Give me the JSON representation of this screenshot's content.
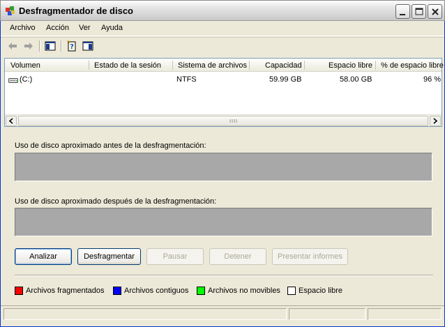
{
  "window": {
    "title": "Desfragmentador de disco",
    "icon": "defrag-app-icon"
  },
  "menu": {
    "items": [
      "Archivo",
      "Acción",
      "Ver",
      "Ayuda"
    ]
  },
  "toolbar": {
    "buttons": [
      "back-arrow-icon",
      "forward-arrow-icon",
      "show-hide-console-tree-icon",
      "help-icon",
      "properties-icon"
    ]
  },
  "volumes": {
    "columns": [
      "Volumen",
      "Estado de la sesión",
      "Sistema de archivos",
      "Capacidad",
      "Espacio libre",
      "% de espacio libre"
    ],
    "rows": [
      {
        "volume": "(C:)",
        "status": "",
        "filesystem": "NTFS",
        "capacity": "59.99 GB",
        "free_space": "58.00 GB",
        "percent_free": "96 %"
      }
    ]
  },
  "usage": {
    "before_label": "Uso de disco aproximado antes de la desfragmentación:",
    "after_label": "Uso de disco aproximado después de la desfragmentación:",
    "bar_color": "#a8a8a8"
  },
  "actions": {
    "analyze": "Analizar",
    "defragment": "Desfragmentar",
    "pause": "Pausar",
    "stop": "Detener",
    "report": "Presentar informes"
  },
  "legend": [
    {
      "label": "Archivos fragmentados",
      "color": "#ff0000"
    },
    {
      "label": "Archivos contiguos",
      "color": "#0000ff"
    },
    {
      "label": "Archivos no movibles",
      "color": "#00ff00"
    },
    {
      "label": "Espacio libre",
      "color": "#ffffff"
    }
  ]
}
